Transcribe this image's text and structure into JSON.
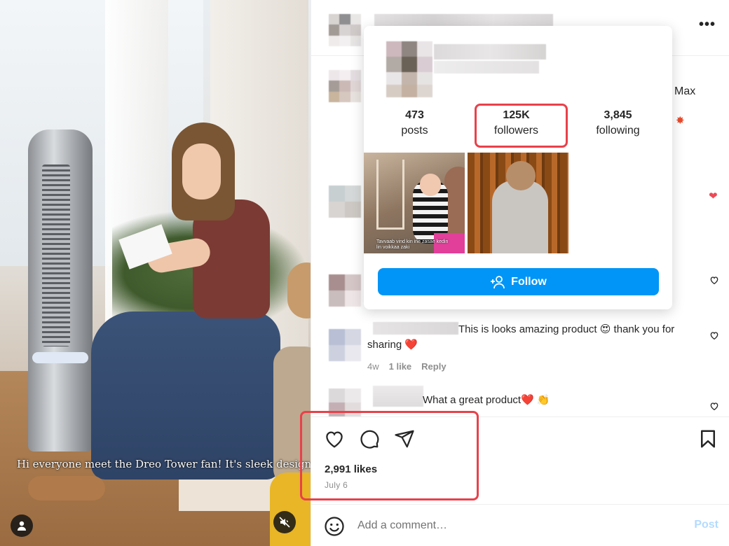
{
  "media": {
    "caption": "Hi everyone meet the Dreo Tower fan! It's sleek design"
  },
  "header": {
    "more_label": "•••"
  },
  "background_text": {
    "fragment_max": "Max"
  },
  "hover_card": {
    "stats": [
      {
        "value": "473",
        "label": "posts"
      },
      {
        "value": "125K",
        "label": "followers"
      },
      {
        "value": "3,845",
        "label": "following"
      }
    ],
    "thumb_caption": "Tavvaab vind kin ine zasae kedin lin voikkaa zaki",
    "follow_label": "Follow"
  },
  "comments": [
    {
      "text": "This is looks amazing product 😍 thank you for sharing ❤️",
      "age": "4w",
      "likes": "1 like",
      "reply": "Reply"
    },
    {
      "text": "What a great product❤️ 👏"
    }
  ],
  "actions": {
    "likes": "2,991 likes",
    "date": "July 6"
  },
  "comment_box": {
    "placeholder": "Add a comment…",
    "post_label": "Post"
  },
  "colors": {
    "accent": "#0095f6",
    "highlight": "#e8414a",
    "like_red": "#ed4956"
  }
}
